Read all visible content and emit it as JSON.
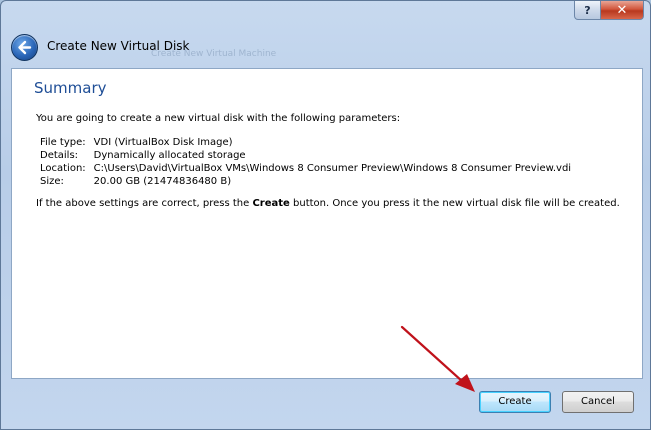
{
  "window": {
    "title": "Create New Virtual Disk",
    "ghost_title": "Create New Virtual Machine",
    "help_label": "?",
    "close_label": "✕"
  },
  "summary": {
    "heading": "Summary",
    "intro": "You are going to create a new virtual disk with the following parameters:",
    "params": [
      {
        "label": "File type:",
        "value": "VDI (VirtualBox Disk Image)"
      },
      {
        "label": "Details:",
        "value": "Dynamically allocated storage"
      },
      {
        "label": "Location:",
        "value": "C:\\Users\\David\\VirtualBox VMs\\Windows 8 Consumer Preview\\Windows 8 Consumer Preview.vdi"
      },
      {
        "label": "Size:",
        "value": "20.00 GB (21474836480 B)"
      }
    ],
    "note_before": "If the above settings are correct, press the ",
    "note_bold": "Create",
    "note_after": " button. Once you press it the new virtual disk file will be created."
  },
  "buttons": {
    "create_label": "Create",
    "cancel_label": "Cancel"
  },
  "colors": {
    "heading": "#1f4e96",
    "arrow": "#c0121b",
    "default_button_border": "#3c7fb1"
  }
}
